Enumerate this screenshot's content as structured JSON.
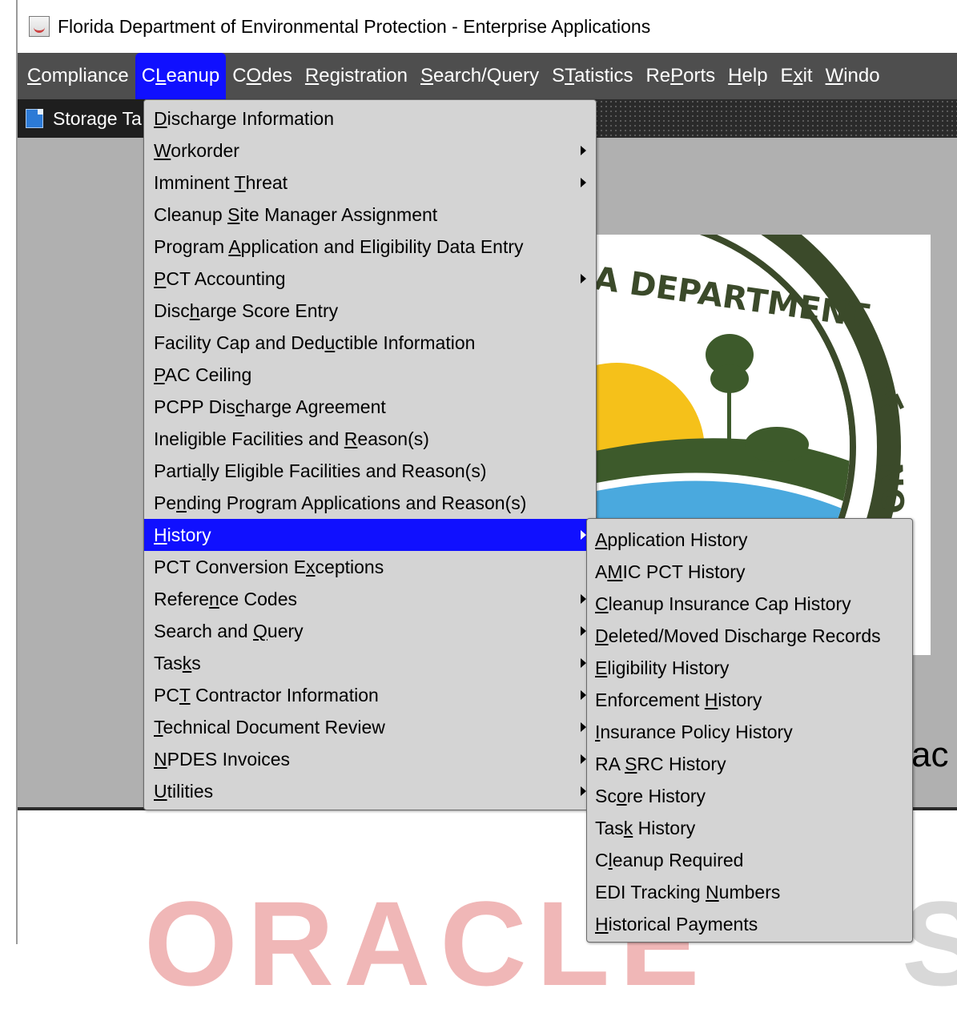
{
  "window": {
    "title": "Florida Department of Environmental Protection - Enterprise Applications"
  },
  "menubar": {
    "items": [
      {
        "pre": "",
        "u": "C",
        "post": "ompliance"
      },
      {
        "pre": "C",
        "u": "L",
        "post": "eanup",
        "active": true
      },
      {
        "pre": "C",
        "u": "O",
        "post": "des"
      },
      {
        "pre": "",
        "u": "R",
        "post": "egistration"
      },
      {
        "pre": "",
        "u": "S",
        "post": "earch/Query"
      },
      {
        "pre": "S",
        "u": "T",
        "post": "atistics"
      },
      {
        "pre": "Re",
        "u": "P",
        "post": "orts"
      },
      {
        "pre": "",
        "u": "H",
        "post": "elp"
      },
      {
        "pre": "E",
        "u": "x",
        "post": "it"
      },
      {
        "pre": "",
        "u": "W",
        "post": "indo"
      }
    ]
  },
  "document_tab": {
    "label": "Storage Ta"
  },
  "background": {
    "partial_text": "ac",
    "watermark": "ORACLE",
    "watermark_right": "S"
  },
  "cleanup_menu": {
    "items": [
      {
        "pre": "",
        "u": "D",
        "post": "ischarge Information",
        "submenu": false
      },
      {
        "pre": "",
        "u": "W",
        "post": "orkorder",
        "submenu": true
      },
      {
        "pre": "Imminent ",
        "u": "T",
        "post": "hreat",
        "submenu": true
      },
      {
        "pre": "Cleanup ",
        "u": "S",
        "post": "ite Manager Assignment",
        "submenu": false
      },
      {
        "pre": "Program ",
        "u": "A",
        "post": "pplication and Eligibility Data Entry",
        "submenu": false
      },
      {
        "pre": "",
        "u": "P",
        "post": "CT Accounting",
        "submenu": true
      },
      {
        "pre": "Disc",
        "u": "h",
        "post": "arge Score Entry",
        "submenu": false
      },
      {
        "pre": "Facility Cap and Ded",
        "u": "u",
        "post": "ctible Information",
        "submenu": false
      },
      {
        "pre": "",
        "u": "P",
        "post": "AC Ceiling",
        "submenu": false
      },
      {
        "pre": "PCPP Dis",
        "u": "c",
        "post": "harge Agreement",
        "submenu": false
      },
      {
        "pre": "Ineligible Facilities and ",
        "u": "R",
        "post": "eason(s)",
        "submenu": false
      },
      {
        "pre": "Partia",
        "u": "l",
        "post": "ly Eligible Facilities and Reason(s)",
        "submenu": false
      },
      {
        "pre": "Pe",
        "u": "n",
        "post": "ding Program Applications and Reason(s)",
        "submenu": false
      },
      {
        "pre": "",
        "u": "H",
        "post": "istory",
        "submenu": true,
        "highlighted": true
      },
      {
        "pre": "PCT Conversion E",
        "u": "x",
        "post": "ceptions",
        "submenu": false
      },
      {
        "pre": "Refere",
        "u": "n",
        "post": "ce Codes",
        "submenu": true
      },
      {
        "pre": "Search and ",
        "u": "Q",
        "post": "uery",
        "submenu": true
      },
      {
        "pre": "Tas",
        "u": "k",
        "post": "s",
        "submenu": true
      },
      {
        "pre": "PC",
        "u": "T",
        "post": " Contractor Information",
        "submenu": true
      },
      {
        "pre": "",
        "u": "T",
        "post": "echnical Document Review",
        "submenu": true
      },
      {
        "pre": "",
        "u": "N",
        "post": "PDES Invoices",
        "submenu": true
      },
      {
        "pre": "",
        "u": "U",
        "post": "tilities",
        "submenu": true
      }
    ]
  },
  "history_menu": {
    "items": [
      {
        "pre": "",
        "u": "A",
        "post": "pplication History"
      },
      {
        "pre": "A",
        "u": "M",
        "post": "IC PCT History"
      },
      {
        "pre": "",
        "u": "C",
        "post": "leanup Insurance Cap History"
      },
      {
        "pre": "",
        "u": "D",
        "post": "eleted/Moved Discharge Records"
      },
      {
        "pre": "",
        "u": "E",
        "post": "ligibility History"
      },
      {
        "pre": "Enforcement ",
        "u": "H",
        "post": "istory"
      },
      {
        "pre": "",
        "u": "I",
        "post": "nsurance Policy History"
      },
      {
        "pre": "RA ",
        "u": "S",
        "post": "RC History"
      },
      {
        "pre": "Sc",
        "u": "o",
        "post": "re History"
      },
      {
        "pre": "Tas",
        "u": "k",
        "post": " History"
      },
      {
        "pre": "C",
        "u": "l",
        "post": "eanup Required"
      },
      {
        "pre": "EDI Tracking ",
        "u": "N",
        "post": "umbers"
      },
      {
        "pre": "",
        "u": "H",
        "post": "istorical Payments"
      }
    ]
  },
  "seal": {
    "text_top": "A DEPARTMENT",
    "text_right": "OF",
    "text_right2": "NO",
    "colors": {
      "ring": "#3b4a2a",
      "sky": "#ffffff",
      "sun": "#f5c11a",
      "water": "#4aa9de",
      "land": "#3d5a2b"
    }
  }
}
